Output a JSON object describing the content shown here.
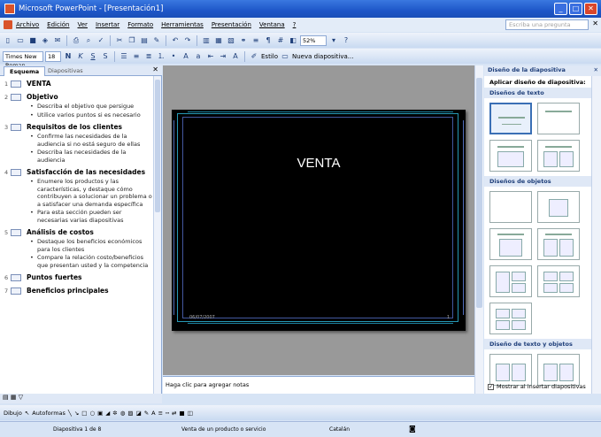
{
  "title": "Microsoft PowerPoint - [Presentación1]",
  "menu": [
    "Archivo",
    "Edición",
    "Ver",
    "Insertar",
    "Formato",
    "Herramientas",
    "Presentación",
    "Ventana",
    "?"
  ],
  "help_placeholder": "Escriba una pregunta",
  "toolbar": {
    "zoom": "52%",
    "font": "Times New Roman",
    "size": "18",
    "bold": "N",
    "italic": "K",
    "underline": "S",
    "shadow": "S",
    "style": "Estilo",
    "new_slide": "Nueva diapositiva..."
  },
  "leftpane": {
    "tab_outline": "Esquema",
    "tab_slides": "Diapositivas",
    "slides": [
      {
        "num": "1",
        "title": "VENTA",
        "bullets": []
      },
      {
        "num": "2",
        "title": "Objetivo",
        "bullets": [
          "Describa el objetivo que persigue",
          "Utilice varios puntos si es necesario"
        ]
      },
      {
        "num": "3",
        "title": "Requisitos de los clientes",
        "bullets": [
          "Confirme las necesidades de la audiencia si no está seguro de ellas",
          "Describa las necesidades de la audiencia"
        ]
      },
      {
        "num": "4",
        "title": "Satisfacción de las necesidades",
        "bullets": [
          "Enumere los productos y las características, y destaque cómo contribuyen a solucionar un problema o a satisfacer una demanda específica",
          "Para esta sección pueden ser necesarias varias diapositivas"
        ]
      },
      {
        "num": "5",
        "title": "Análisis de costos",
        "bullets": [
          "Destaque los beneficios económicos para los clientes",
          "Compare la relación costo/beneficios que presentan usted y la competencia"
        ]
      },
      {
        "num": "6",
        "title": "Puntos fuertes",
        "bullets": []
      },
      {
        "num": "7",
        "title": "Beneficios principales",
        "bullets": []
      }
    ]
  },
  "slide": {
    "title": "VENTA",
    "date": "06/07/2007",
    "page": "1"
  },
  "notes_placeholder": "Haga clic para agregar notas",
  "taskpane": {
    "title": "Diseño de la diapositiva",
    "apply": "Aplicar diseño de diapositiva:",
    "sec_text": "Diseños de texto",
    "sec_objects": "Diseños de objetos",
    "sec_textobj": "Diseño de texto y objetos",
    "show_on_insert": "Mostrar al insertar diapositivas"
  },
  "drawtb": {
    "draw": "Dibujo",
    "autoshapes": "Autoformas"
  },
  "status": {
    "slide": "Diapositiva 1 de 8",
    "design": "Venta de un producto o servicio",
    "lang": "Catalán"
  }
}
